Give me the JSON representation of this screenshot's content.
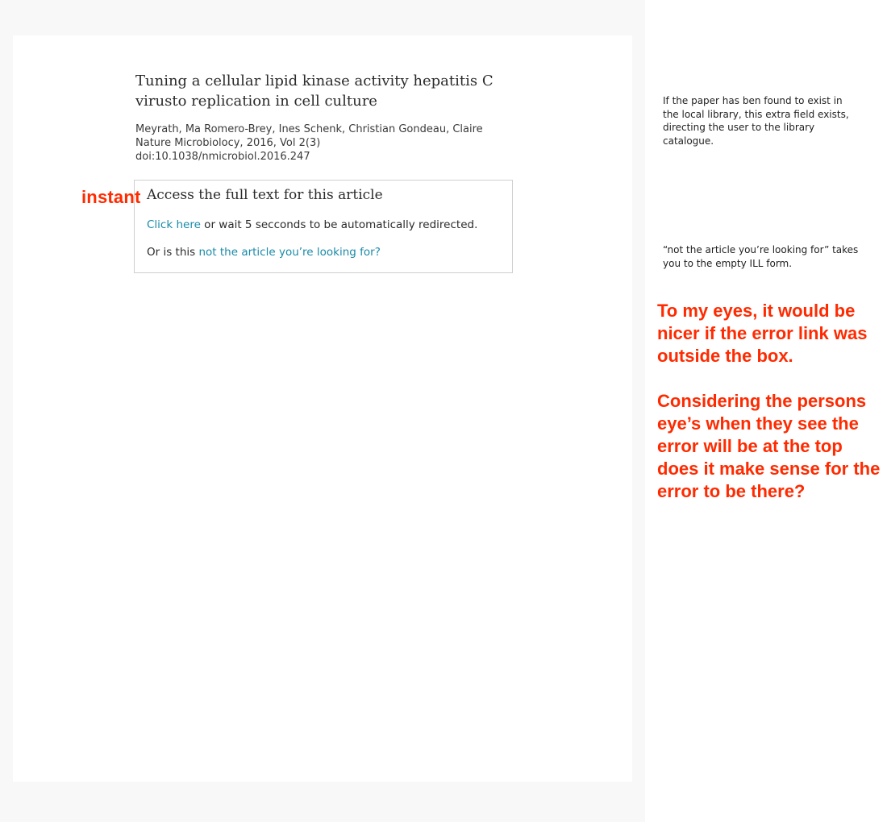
{
  "article": {
    "title": "Tuning a cellular lipid kinase activity hepatitis C virusto replication in cell culture",
    "authors": "Meyrath, Ma Romero-Brey, Ines Schenk, Christian Gondeau, Claire",
    "journal": "Nature Microbiolocy, 2016, Vol 2(3)",
    "doi": "doi:10.1038/nmicrobiol.2016.247"
  },
  "access_box": {
    "heading": "Access the full text for this article",
    "click_here_link": "Click here",
    "redirect_text": " or wait 5 secconds to be automatically redirected.",
    "error_prefix": "Or is this ",
    "error_link": "not the article you’re looking for?"
  },
  "annotations": {
    "instant_label": "instant",
    "note_library": "If the paper has ben found to exist in the local library, this extra field exists, directing the user to the library catalogue.",
    "note_ill": "“not the article you’re looking for” takes you to the empty ILL form.",
    "comment_1": "To my eyes, it would be nicer if the error link was outside the box.",
    "comment_2": "Considering the persons eye’s when they see the error will be at the top does it make sense for the error to be there?"
  },
  "colors": {
    "link": "#1a8aa8",
    "annotation_red": "#ff2a00"
  }
}
